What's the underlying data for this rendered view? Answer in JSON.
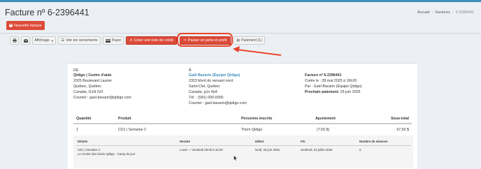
{
  "page": {
    "title": "Facture nº 6-2396441"
  },
  "breadcrumb": [
    "Accueil",
    "Factures",
    "6-2396441"
  ],
  "buttons": {
    "new_invoice": "Nouvelle facture"
  },
  "toolbar": {
    "display": "Affichage",
    "view_payments": "Voir les versements",
    "pay": "Payer",
    "credit_note": "Créer une note de crédit",
    "write_off": "Passer en perte et profit",
    "payment": "Paiement (1)"
  },
  "invoice": {
    "from": {
      "label": "DE",
      "name": "Qidigo | Centre d'aide",
      "address1": "2025 Boulevard Laurier",
      "address2": "Québec, Québec",
      "address3": "Canada, G1N 0J3",
      "email": "Courriel : gael.bavarin@qidigo.com"
    },
    "to": {
      "label": "À",
      "name": "Gaël Bavarin (Équipe Qidigo)",
      "address1": "2323 blvrd du versant nord",
      "address2": "Saint-Clet, Québec",
      "address3": "Canada, g1n 4p4",
      "phone": "Tél. : (581) 000-0000",
      "email": "Courriel : gael.bavarin@qidigo.com"
    },
    "meta": {
      "number": "Facture nº 6-2396441",
      "created": "Créée le : 28 mai 2025 à 16h20",
      "by": "Par : Gaël Bavarin (Équipe Qidigo)",
      "next_payment_label": "Prochain paiement:",
      "next_payment": "29 juin 2025"
    },
    "table": {
      "headers": {
        "qty": "Quantité",
        "product": "Produit",
        "person": "Personne inscrite",
        "adjustment": "Ajustement",
        "subtotal": "Sous-total"
      },
      "rows": [
        {
          "qty": "1",
          "product": "CDJ | Semaine 2",
          "person": "Thom Qidigo",
          "adjustment": "(7,50 $)",
          "subtotal": "67,50 $"
        }
      ]
    },
    "details": {
      "headers": {
        "details": "Détails",
        "schedule": "Horaire",
        "start": "Début",
        "end": "Fin",
        "sessions": "Nombre de séances"
      },
      "row": {
        "line1": "CDJ | Semaine 2",
        "line2": "Le Centre des loisirs Qidigo · Camp de jour",
        "schedule": "Lundi — Vendredi 09:00 à 16:30",
        "start": "lundi, 29 juin 2026",
        "end": "vendredi, 03 juillet 2026",
        "sessions": "5"
      }
    }
  },
  "colors": {
    "accent": "#3c8dbc",
    "danger": "#dd4b39",
    "annotation": "#e8452c"
  }
}
